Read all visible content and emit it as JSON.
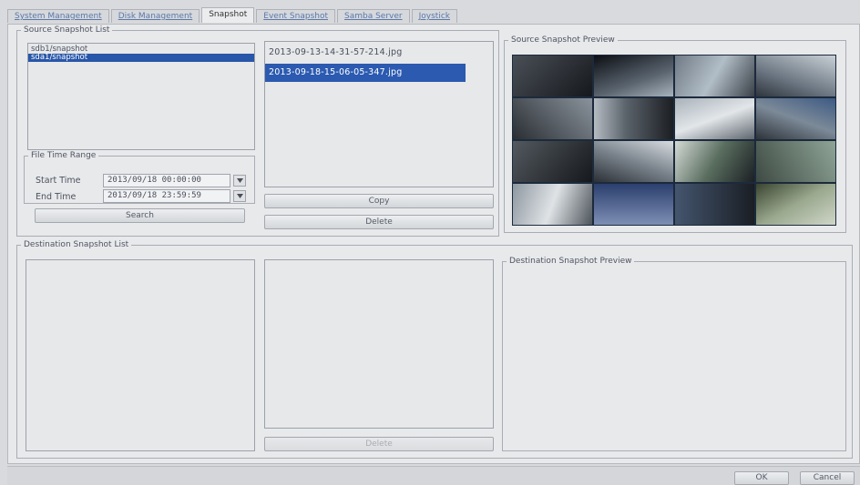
{
  "tabs": [
    {
      "label": "System Management",
      "active": false
    },
    {
      "label": "Disk Management",
      "active": false
    },
    {
      "label": "Snapshot",
      "active": true
    },
    {
      "label": "Event Snapshot",
      "active": false
    },
    {
      "label": "Samba Server",
      "active": false
    },
    {
      "label": "Joystick",
      "active": false
    }
  ],
  "source": {
    "group_title": "Source Snapshot List",
    "folders": [
      {
        "label": "sdb1/snapshot",
        "selected": false
      },
      {
        "label": "sda1/snapshot",
        "selected": true
      }
    ],
    "time_range": {
      "group_title": "File Time Range",
      "start_label": "Start Time",
      "start_value": "2013/09/18 00:00:00",
      "end_label": "End Time",
      "end_value": "2013/09/18 23:59:59"
    },
    "search_label": "Search",
    "files": [
      {
        "label": "2013-09-13-14-31-57-214.jpg",
        "selected": false
      },
      {
        "label": "2013-09-18-15-06-05-347.jpg",
        "selected": true
      }
    ],
    "copy_label": "Copy",
    "delete_label": "Delete",
    "preview_title": "Source Snapshot Preview"
  },
  "destination": {
    "group_title": "Destination Snapshot List",
    "delete_label": "Delete",
    "preview_title": "Destination Snapshot Preview"
  },
  "footer": {
    "ok_label": "OK",
    "cancel_label": "Cancel"
  },
  "colors": {
    "selection": "#2b5ab0",
    "page": "#e8e9eb",
    "preview_bg": "#1c2a3c"
  },
  "icons": {
    "dropdown": "chevron-down-icon"
  }
}
